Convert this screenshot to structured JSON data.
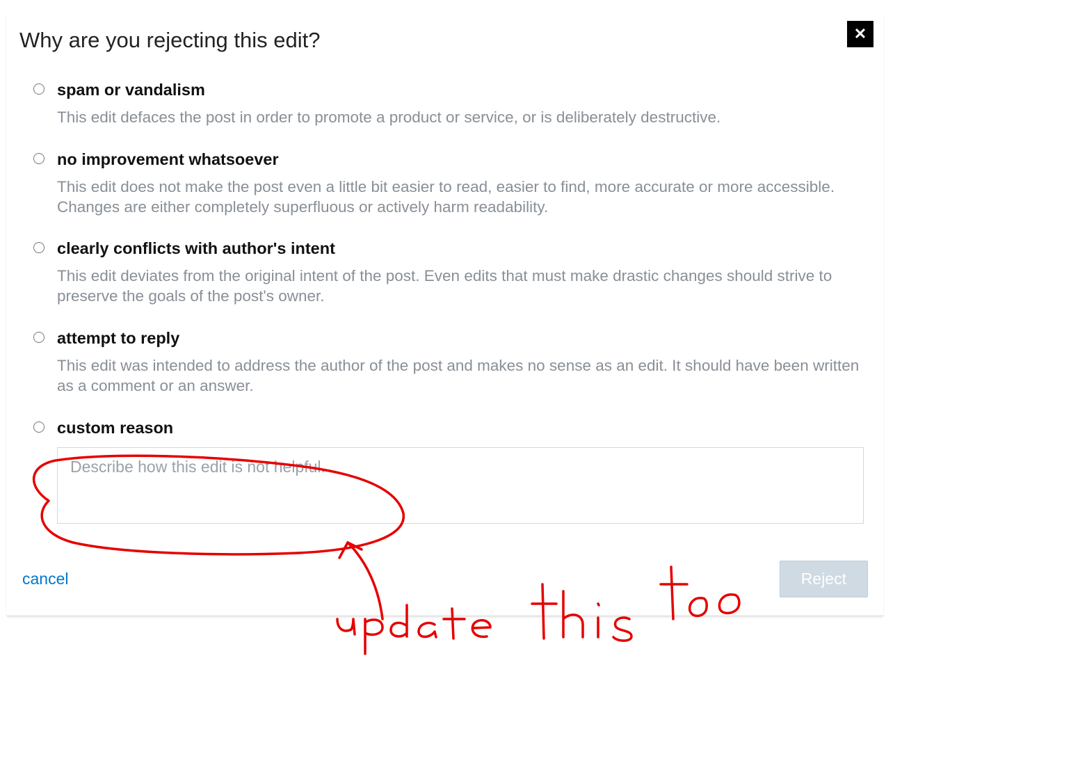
{
  "dialog": {
    "title": "Why are you rejecting this edit?",
    "options": [
      {
        "id": "spam",
        "title": "spam or vandalism",
        "desc": "This edit defaces the post in order to promote a product or service, or is deliberately destructive."
      },
      {
        "id": "no-improvement",
        "title": "no improvement whatsoever",
        "desc": "This edit does not make the post even a little bit easier to read, easier to find, more accurate or more accessible. Changes are either completely superfluous or actively harm readability."
      },
      {
        "id": "conflicts",
        "title": "clearly conflicts with author's intent",
        "desc": "This edit deviates from the original intent of the post. Even edits that must make drastic changes should strive to preserve the goals of the post's owner."
      },
      {
        "id": "reply",
        "title": "attempt to reply",
        "desc": "This edit was intended to address the author of the post and makes no sense as an edit. It should have been written as a comment or an answer."
      },
      {
        "id": "custom",
        "title": "custom reason",
        "placeholder": "Describe how this edit is not helpful."
      }
    ],
    "footer": {
      "cancel": "cancel",
      "reject": "Reject"
    }
  },
  "annotation": {
    "text": "update this too",
    "color": "#e60000"
  }
}
